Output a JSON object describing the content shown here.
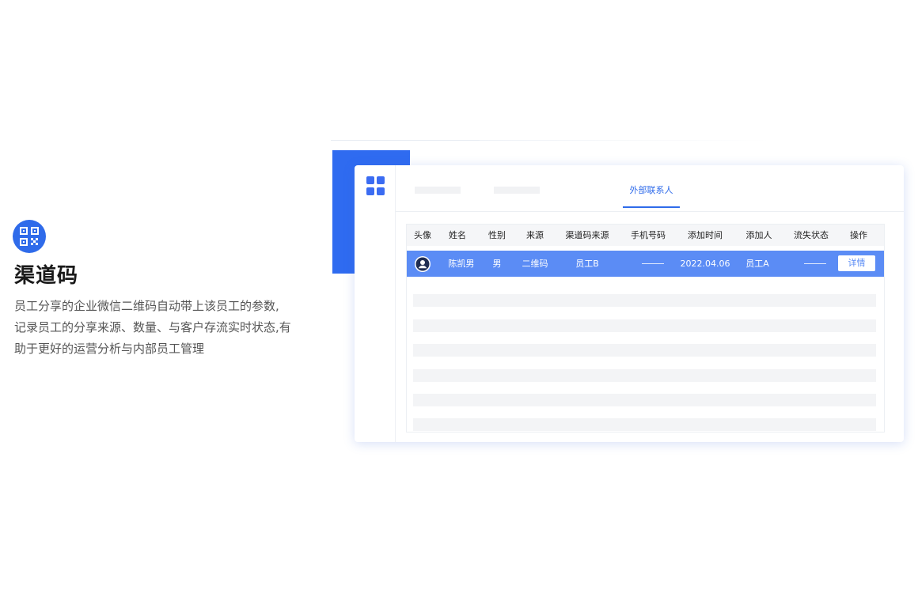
{
  "feature": {
    "icon": "qr-code-icon",
    "title": "渠道码",
    "description_lines": [
      "员工分享的企业微信二维码自动带上该员工的参数,",
      "记录员工的分享来源、数量、与客户存流实时状态,有",
      "助于更好的运营分析与内部员工管理"
    ]
  },
  "app": {
    "menu_icon": "grid-icon",
    "active_tab": "外部联系人",
    "table": {
      "columns": [
        "头像",
        "姓名",
        "性别",
        "来源",
        "渠道码来源",
        "手机号码",
        "添加时间",
        "添加人",
        "流失状态",
        "操作"
      ],
      "selected_row": {
        "avatar_icon": "user-avatar-icon",
        "name": "陈凯男",
        "gender": "男",
        "source": "二维码",
        "channel_source": "员工B",
        "phone": "",
        "added_time": "2022.04.06",
        "added_by": "员工A",
        "churn_status": "",
        "action": "详情"
      }
    }
  },
  "colors": {
    "accent": "#2f6bea",
    "selected_row": "#5b8cf5",
    "placeholder": "#f3f4f6"
  }
}
